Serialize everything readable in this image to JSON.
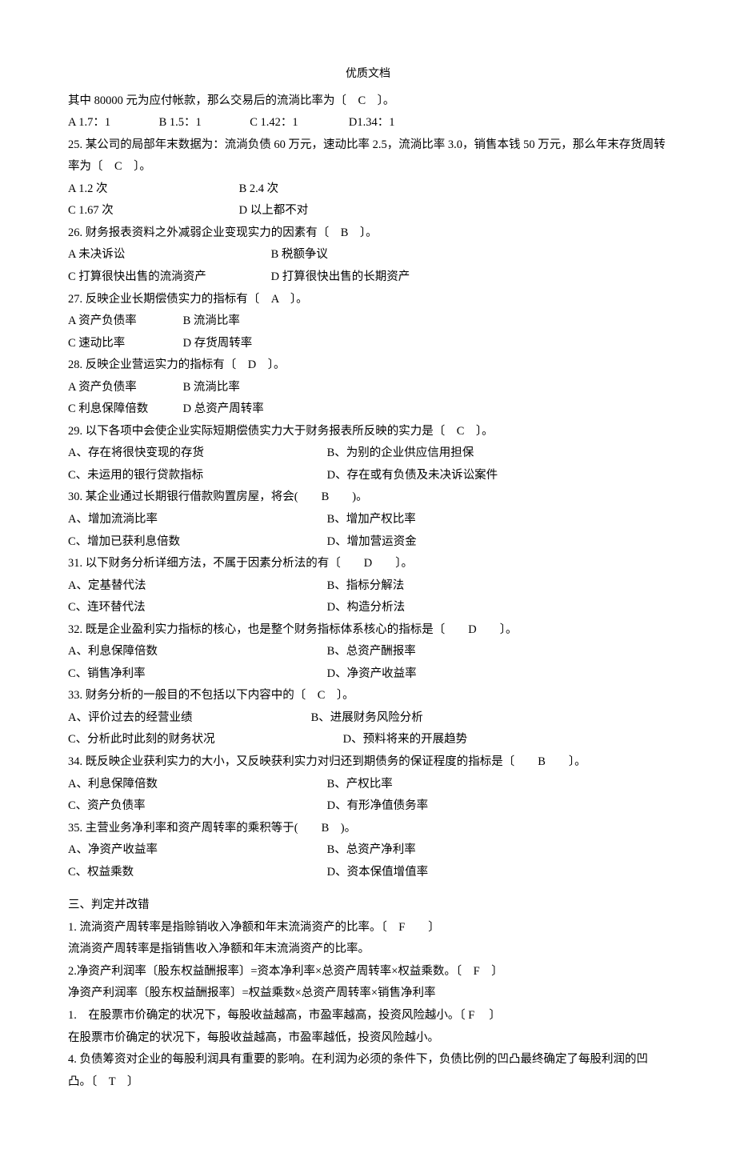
{
  "header": {
    "title": "优质文档"
  },
  "body": {
    "l0": "其中 80000 元为应付帐款，那么交易后的流淌比率为〔　C　〕。",
    "l1_a": "A 1.7：1",
    "l1_b": "B 1.5：1",
    "l1_c": "C 1.42：1",
    "l1_d": "D1.34：1",
    "q25a": "25. 某公司的局部年末数据为：流淌负债 60 万元，速动比率 2.5，流淌比率 3.0，销售本钱 50 万元，那么年末存货周转率为〔　C　〕。",
    "q25_oa": "A 1.2 次",
    "q25_ob": "B 2.4 次",
    "q25_oc": "C 1.67 次",
    "q25_od": "D 以上都不对",
    "q26": "26. 财务报表资料之外减弱企业变现实力的因素有〔　B　〕。",
    "q26_oa": "A 未决诉讼",
    "q26_ob": "B 税额争议",
    "q26_oc": "C 打算很快出售的流淌资产",
    "q26_od": "D 打算很快出售的长期资产",
    "q27": "27. 反映企业长期偿债实力的指标有〔　A　〕。",
    "q27_oa": "A 资产负债率",
    "q27_ob": "B 流淌比率",
    "q27_oc": "C 速动比率",
    "q27_od": "D 存货周转率",
    "q28": "28. 反映企业营运实力的指标有〔　D　〕。",
    "q28_oa": "A 资产负债率",
    "q28_ob": "B 流淌比率",
    "q28_oc": "C 利息保障倍数",
    "q28_od": "D 总资产周转率",
    "q29": "29. 以下各项中会使企业实际短期偿债实力大于财务报表所反映的实力是〔　C　〕。",
    "q29_oa": "A、存在将很快变现的存货",
    "q29_ob": "B、为别的企业供应信用担保",
    "q29_oc": "C、未运用的银行贷款指标",
    "q29_od": "D、存在或有负债及未决诉讼案件",
    "q30": "30. 某企业通过长期银行借款购置房屋，将会(　　B　　)。",
    "q30_oa": "A、增加流淌比率",
    "q30_ob": "B、增加产权比率",
    "q30_oc": "C、增加已获利息倍数",
    "q30_od": "D、增加营运资金",
    "q31": "31. 以下财务分析详细方法，不属于因素分析法的有〔　　D　　〕。",
    "q31_oa": "A、定基替代法",
    "q31_ob": "B、指标分解法",
    "q31_oc": "C、连环替代法",
    "q31_od": "D、构造分析法",
    "q32": "32. 既是企业盈利实力指标的核心，也是整个财务指标体系核心的指标是〔　　D　　〕。",
    "q32_oa": "A、利息保障倍数",
    "q32_ob": "B、总资产酬报率",
    "q32_oc": "C、销售净利率",
    "q32_od": "D、净资产收益率",
    "q33": "33. 财务分析的一般目的不包括以下内容中的〔　C　〕。",
    "q33_oa": "A、评价过去的经营业绩",
    "q33_ob": "B、进展财务风险分析",
    "q33_oc": "C、分析此时此刻的财务状况",
    "q33_od": "D、预料将来的开展趋势",
    "q34": "34. 既反映企业获利实力的大小，又反映获利实力对归还到期债务的保证程度的指标是〔　　B　　〕。",
    "q34_oa": "A、利息保障倍数",
    "q34_ob": "B、产权比率",
    "q34_oc": "C、资产负债率",
    "q34_od": "D、有形净值债务率",
    "q35": "35. 主营业务净利率和资产周转率的乘积等于(　　B　)。",
    "q35_oa": "A、净资产收益率",
    "q35_ob": "B、总资产净利率",
    "q35_oc": "C、权益乘数",
    "q35_od": "D、资本保值增值率",
    "sec3": "三、判定并改错",
    "j1": "1. 流淌资产周转率是指赊销收入净额和年末流淌资产的比率。〔　F　　〕",
    "j1c": "流淌资产周转率是指销售收入净额和年末流淌资产的比率。",
    "j2": "2.净资产利润率〔股东权益酬报率〕=资本净利率×总资产周转率×权益乘数。〔　F　〕",
    "j2c": "净资产利润率〔股东权益酬报率〕=权益乘数×总资产周转率×销售净利率",
    "j3": "1.　在股票市价确定的状况下，每股收益越高，市盈率越高，投资风险越小。〔 F 　〕",
    "j3c": "在股票市价确定的状况下，每股收益越高，市盈率越低，投资风险越小。",
    "j4": "4. 负债筹资对企业的每股利润具有重要的影响。在利润为必须的条件下，负债比例的凹凸最终确定了每股利润的凹凸。〔　T　〕"
  }
}
